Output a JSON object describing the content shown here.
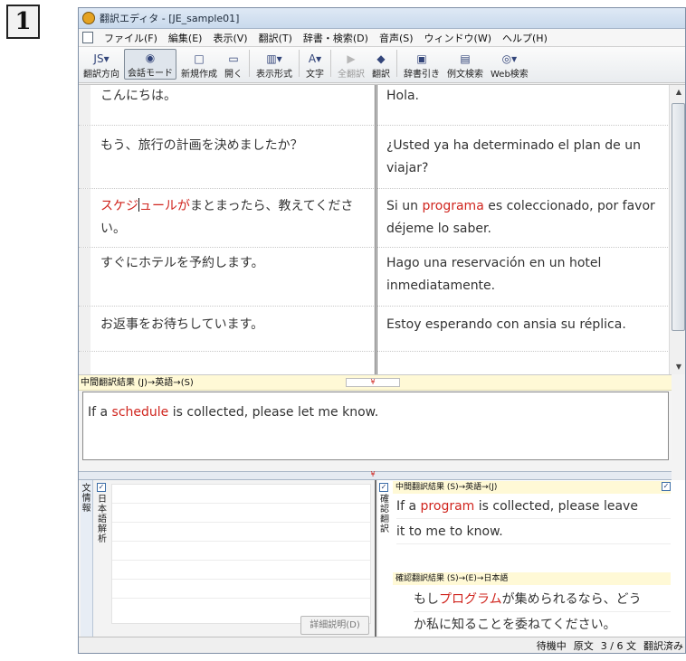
{
  "step_badge": "1",
  "window": {
    "title": "翻訳エディタ - [JE_sample01]"
  },
  "menu": [
    "ファイル(F)",
    "編集(E)",
    "表示(V)",
    "翻訳(T)",
    "辞書・検索(D)",
    "音声(S)",
    "ウィンドウ(W)",
    "ヘルプ(H)"
  ],
  "toolbar": [
    {
      "icon": "JS▾",
      "label": "翻訳方向",
      "icon_name": "direction-icon",
      "state": "normal"
    },
    {
      "icon": "◉",
      "label": "会話モード",
      "icon_name": "conversation-mode-icon",
      "state": "active"
    },
    {
      "icon": "□",
      "label": "新規作成",
      "icon_name": "new-document-icon",
      "state": "normal"
    },
    {
      "icon": "▭",
      "label": "開く",
      "icon_name": "open-folder-icon",
      "state": "normal"
    },
    {
      "icon": "▥▾",
      "label": "表示形式",
      "icon_name": "display-format-icon",
      "state": "normal"
    },
    {
      "icon": "A▾",
      "label": "文字",
      "icon_name": "font-icon",
      "state": "normal"
    },
    {
      "icon": "▶",
      "label": "全翻訳",
      "icon_name": "translate-all-icon",
      "state": "disabled"
    },
    {
      "icon": "◆",
      "label": "翻訳",
      "icon_name": "translate-icon",
      "state": "normal"
    },
    {
      "icon": "▣",
      "label": "辞書引き",
      "icon_name": "dictionary-icon",
      "state": "normal"
    },
    {
      "icon": "▤",
      "label": "例文検索",
      "icon_name": "example-search-icon",
      "state": "normal"
    },
    {
      "icon": "◎▾",
      "label": "Web検索",
      "icon_name": "web-search-icon",
      "state": "normal"
    }
  ],
  "rows": [
    {
      "ja": "こんにちは。",
      "es": "Hola."
    },
    {
      "ja": "もう、旅行の計画を決めましたか？",
      "es": "¿Usted ya ha determinado el plan de un viajar?"
    },
    {
      "ja_hl": "スケジュールが",
      "ja_hl_a": "スケジ",
      "ja_hl_b": "ュールが",
      "ja_rest": "まとまったら、教えてください。",
      "es_pre": "Si un ",
      "es_hl": "programa",
      "es_post": " es coleccionado, por favor déjeme lo saber."
    },
    {
      "ja": "すぐにホテルを予約します。",
      "es": "Hago una reservación en un hotel inmediatamente."
    },
    {
      "ja": "お返事をお待ちしています。",
      "es": "Estoy esperando con ansia su réplica."
    }
  ],
  "intermediate": {
    "label": "中間翻訳結果 (J)→英語→(S)",
    "pre": "If a ",
    "hl": "schedule",
    "post": " is collected, please let me know."
  },
  "info_panel": {
    "tab_label": "文情報",
    "analysis_label": "日本語解析",
    "detail_button": "詳細説明(D)"
  },
  "confirm_panel": {
    "tab_label": "確認翻訳",
    "mid_label": "中間翻訳結果 (S)→英語→(J)",
    "mid_pre": "If a ",
    "mid_hl": "program",
    "mid_post": " is collected, please leave",
    "mid_line2": "it to me to know.",
    "result_label": "確認翻訳結果 (S)→(E)→日本語",
    "res_pre": "もし",
    "res_hl": "プログラム",
    "res_post": "が集められるなら、どう",
    "res_line2": "か私に知ることを委ねてください。"
  },
  "status": {
    "state": "待機中",
    "mode": "原文",
    "count": "3 / 6 文",
    "flag": "翻訳済み"
  },
  "colors": {
    "highlight": "#d0251e",
    "label_bg": "#fff9d6"
  }
}
